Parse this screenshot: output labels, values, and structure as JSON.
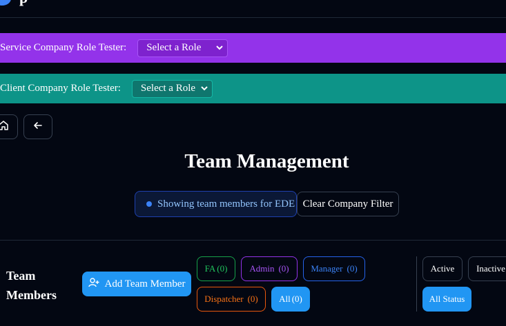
{
  "header": {
    "logo_text": "p"
  },
  "service_tester": {
    "label": "Service Company Role Tester:",
    "selected": "Select a Role"
  },
  "client_tester": {
    "label": "Client Company Role Tester:",
    "selected": "Select a Role"
  },
  "nav": {
    "home_icon": "home-icon",
    "back_icon": "arrow-left-icon"
  },
  "page": {
    "title": "Team Management"
  },
  "company_filter": {
    "text": "Showing team members for EDE",
    "clear_label": "Clear Company Filter"
  },
  "team": {
    "title_line1": "Team",
    "title_line2": "Members",
    "add_label": "Add Team Member"
  },
  "role_filters": {
    "fa": {
      "label": "FA",
      "count": "(0)"
    },
    "admin": {
      "label": "Admin",
      "count": "(0)"
    },
    "manager": {
      "label": "Manager",
      "count": "(0)"
    },
    "dispatcher": {
      "label": "Dispatcher",
      "count": "(0)"
    },
    "all": {
      "label": "All",
      "count": "(0)"
    }
  },
  "status_filters": {
    "active": "Active",
    "inactive": "Inactive",
    "all": "All Status"
  },
  "colors": {
    "background": "#030712",
    "service_bar": "#9333ea",
    "client_bar": "#0d9488",
    "primary": "#2196f3"
  }
}
